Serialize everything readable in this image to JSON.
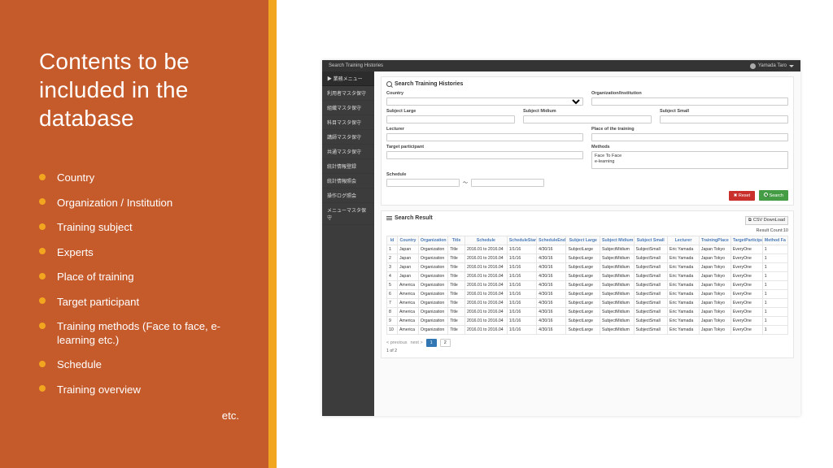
{
  "slide": {
    "title": "Contents to be included in the database",
    "bullets": [
      "Country",
      "Organization / Institution",
      "Training subject",
      "Experts",
      "Place of training",
      "Target participant",
      "Training methods (Face to face, e-learning etc.)",
      "Schedule",
      "Training overview"
    ],
    "etc": "etc."
  },
  "app": {
    "topbar_title": "Search Training Histories",
    "user_name": "Yamada Taro",
    "sidebar_header": "▶ 業務メニュー",
    "sidebar_items": [
      "利用者マスタ保守",
      "組織マスタ保守",
      "科目マスタ保守",
      "講師マスタ保守",
      "共通マスタ保守",
      "統計情報登録",
      "統計情報照会",
      "操作ログ照会",
      "メニューマスタ保守"
    ]
  },
  "search": {
    "panel_title": "Search Training Histories",
    "labels": {
      "country": "Country",
      "organization": "Organization/Institution",
      "subject_large": "Subject Large",
      "subject_midium": "Subject Midium",
      "subject_small": "Subject Small",
      "lecturer": "Lecturer",
      "place": "Place of the training",
      "target": "Target participant",
      "methods": "Methods",
      "schedule": "Schedule"
    },
    "methods_options": [
      "Face To Face",
      "e-learning"
    ],
    "tilde": "～",
    "reset_label": "Reset",
    "search_label": "Search"
  },
  "result": {
    "panel_title": "Search Result",
    "csv_label": "CSV DownLoad",
    "count_label": "Result Count:10",
    "columns": [
      "Id",
      "Country",
      "Organization",
      "Title",
      "Schedule",
      "ScheduleStart",
      "ScheduleEnd",
      "Subject Large",
      "Subject Midium",
      "Subject Small",
      "Lecturer",
      "TrainingPlace",
      "TargetParticipant",
      "Method Fa"
    ],
    "col_widths": [
      "2.5%",
      "5%",
      "7%",
      "4%",
      "10%",
      "7%",
      "7%",
      "8%",
      "8%",
      "8%",
      "7.5%",
      "7.5%",
      "7.5%",
      "6%"
    ],
    "rows": [
      {
        "id": "1",
        "country": "Japan",
        "org": "Organization",
        "title": "Title",
        "schedule": "2016.01 to 2016.04",
        "start": "1/1/16",
        "end": "4/30/16",
        "sl": "SubjectLarge",
        "sm": "SubjectMidium",
        "ss": "SubjectSmall",
        "lec": "Eric Yamada",
        "place": "Japan Tokyo",
        "target": "EveryOne",
        "mf": "1"
      },
      {
        "id": "2",
        "country": "Japan",
        "org": "Organization",
        "title": "Title",
        "schedule": "2016.01 to 2016.04",
        "start": "1/1/16",
        "end": "4/30/16",
        "sl": "SubjectLarge",
        "sm": "SubjectMidium",
        "ss": "SubjectSmall",
        "lec": "Eric Yamada",
        "place": "Japan Tokyo",
        "target": "EveryOne",
        "mf": "1"
      },
      {
        "id": "3",
        "country": "Japan",
        "org": "Organization",
        "title": "Title",
        "schedule": "2016.01 to 2016.04",
        "start": "1/1/16",
        "end": "4/30/16",
        "sl": "SubjectLarge",
        "sm": "SubjectMidium",
        "ss": "SubjectSmall",
        "lec": "Eric Yamada",
        "place": "Japan Tokyo",
        "target": "EveryOne",
        "mf": "1"
      },
      {
        "id": "4",
        "country": "Japan",
        "org": "Organization",
        "title": "Title",
        "schedule": "2016.01 to 2016.04",
        "start": "1/1/16",
        "end": "4/30/16",
        "sl": "SubjectLarge",
        "sm": "SubjectMidium",
        "ss": "SubjectSmall",
        "lec": "Eric Yamada",
        "place": "Japan Tokyo",
        "target": "EveryOne",
        "mf": "1"
      },
      {
        "id": "5",
        "country": "America",
        "org": "Organization",
        "title": "Title",
        "schedule": "2016.01 to 2016.04",
        "start": "1/1/16",
        "end": "4/30/16",
        "sl": "SubjectLarge",
        "sm": "SubjectMidium",
        "ss": "SubjectSmall",
        "lec": "Eric Yamada",
        "place": "Japan Tokyo",
        "target": "EveryOne",
        "mf": "1"
      },
      {
        "id": "6",
        "country": "America",
        "org": "Organization",
        "title": "Title",
        "schedule": "2016.01 to 2016.04",
        "start": "1/1/16",
        "end": "4/30/16",
        "sl": "SubjectLarge",
        "sm": "SubjectMidium",
        "ss": "SubjectSmall",
        "lec": "Eric Yamada",
        "place": "Japan Tokyo",
        "target": "EveryOne",
        "mf": "1"
      },
      {
        "id": "7",
        "country": "America",
        "org": "Organization",
        "title": "Title",
        "schedule": "2016.01 to 2016.04",
        "start": "1/1/16",
        "end": "4/30/16",
        "sl": "SubjectLarge",
        "sm": "SubjectMidium",
        "ss": "SubjectSmall",
        "lec": "Eric Yamada",
        "place": "Japan Tokyo",
        "target": "EveryOne",
        "mf": "1"
      },
      {
        "id": "8",
        "country": "America",
        "org": "Organization",
        "title": "Title",
        "schedule": "2016.01 to 2016.04",
        "start": "1/1/16",
        "end": "4/30/16",
        "sl": "SubjectLarge",
        "sm": "SubjectMidium",
        "ss": "SubjectSmall",
        "lec": "Eric Yamada",
        "place": "Japan Tokyo",
        "target": "EveryOne",
        "mf": "1"
      },
      {
        "id": "9",
        "country": "America",
        "org": "Organization",
        "title": "Title",
        "schedule": "2016.01 to 2016.04",
        "start": "1/1/16",
        "end": "4/30/16",
        "sl": "SubjectLarge",
        "sm": "SubjectMidium",
        "ss": "SubjectSmall",
        "lec": "Eric Yamada",
        "place": "Japan Tokyo",
        "target": "EveryOne",
        "mf": "1"
      },
      {
        "id": "10",
        "country": "America",
        "org": "Organization",
        "title": "Title",
        "schedule": "2016.01 to 2016.04",
        "start": "1/1/16",
        "end": "4/30/16",
        "sl": "SubjectLarge",
        "sm": "SubjectMidium",
        "ss": "SubjectSmall",
        "lec": "Eric Yamada",
        "place": "Japan Tokyo",
        "target": "EveryOne",
        "mf": "1"
      }
    ],
    "pager": {
      "prev": "< previous",
      "next": "next >",
      "pages": [
        "1",
        "2"
      ],
      "current": "1",
      "of_text": "1 of 2"
    }
  }
}
